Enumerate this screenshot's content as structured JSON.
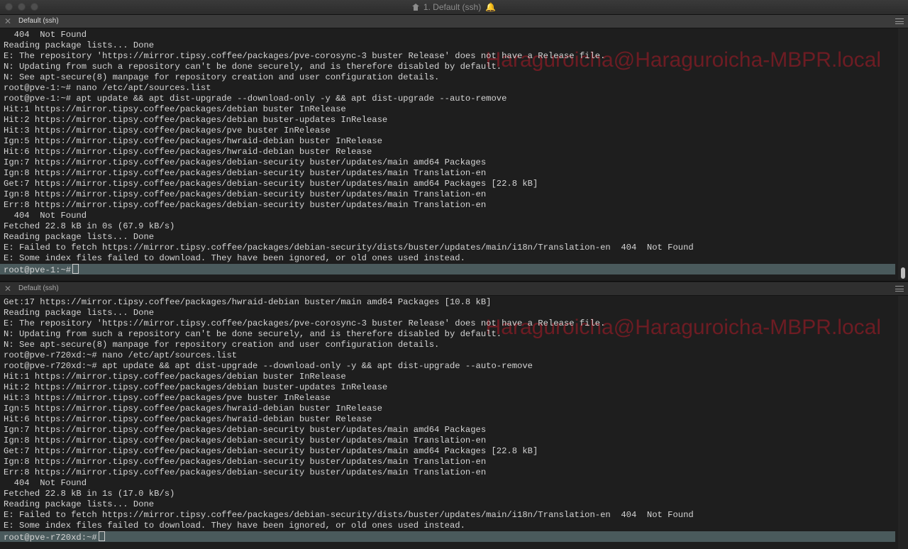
{
  "window": {
    "title": "1. Default (ssh)"
  },
  "colors": {
    "background": "#1e1e1e",
    "text": "#d4d4d4",
    "prompt_highlight": "#4a5a5c",
    "badge": "#af1c28",
    "bell": "#e0b400"
  },
  "top_pane": {
    "tab_label": "Default (ssh)",
    "badge": "Haraguroicha@Haraguroicha-MBPR.local",
    "lines": [
      "  404  Not Found",
      "Reading package lists... Done",
      "E: The repository 'https://mirror.tipsy.coffee/packages/pve-corosync-3 buster Release' does not have a Release file.",
      "N: Updating from such a repository can't be done securely, and is therefore disabled by default.",
      "N: See apt-secure(8) manpage for repository creation and user configuration details.",
      "root@pve-1:~# nano /etc/apt/sources.list",
      "root@pve-1:~# apt update && apt dist-upgrade --download-only -y && apt dist-upgrade --auto-remove",
      "Hit:1 https://mirror.tipsy.coffee/packages/debian buster InRelease",
      "Hit:2 https://mirror.tipsy.coffee/packages/debian buster-updates InRelease",
      "Hit:3 https://mirror.tipsy.coffee/packages/pve buster InRelease",
      "Ign:5 https://mirror.tipsy.coffee/packages/hwraid-debian buster InRelease",
      "Hit:6 https://mirror.tipsy.coffee/packages/hwraid-debian buster Release",
      "Ign:7 https://mirror.tipsy.coffee/packages/debian-security buster/updates/main amd64 Packages",
      "Ign:8 https://mirror.tipsy.coffee/packages/debian-security buster/updates/main Translation-en",
      "Get:7 https://mirror.tipsy.coffee/packages/debian-security buster/updates/main amd64 Packages [22.8 kB]",
      "Ign:8 https://mirror.tipsy.coffee/packages/debian-security buster/updates/main Translation-en",
      "Err:8 https://mirror.tipsy.coffee/packages/debian-security buster/updates/main Translation-en",
      "  404  Not Found",
      "Fetched 22.8 kB in 0s (67.9 kB/s)",
      "Reading package lists... Done",
      "E: Failed to fetch https://mirror.tipsy.coffee/packages/debian-security/dists/buster/updates/main/i18n/Translation-en  404  Not Found",
      "E: Some index files failed to download. They have been ignored, or old ones used instead."
    ],
    "prompt": "root@pve-1:~#"
  },
  "bottom_pane": {
    "tab_label": "Default (ssh)",
    "badge": "Haraguroicha@Haraguroicha-MBPR.local",
    "lines": [
      "Get:17 https://mirror.tipsy.coffee/packages/hwraid-debian buster/main amd64 Packages [10.8 kB]",
      "Reading package lists... Done",
      "E: The repository 'https://mirror.tipsy.coffee/packages/pve-corosync-3 buster Release' does not have a Release file.",
      "N: Updating from such a repository can't be done securely, and is therefore disabled by default.",
      "N: See apt-secure(8) manpage for repository creation and user configuration details.",
      "root@pve-r720xd:~# nano /etc/apt/sources.list",
      "root@pve-r720xd:~# apt update && apt dist-upgrade --download-only -y && apt dist-upgrade --auto-remove",
      "Hit:1 https://mirror.tipsy.coffee/packages/debian buster InRelease",
      "Hit:2 https://mirror.tipsy.coffee/packages/debian buster-updates InRelease",
      "Hit:3 https://mirror.tipsy.coffee/packages/pve buster InRelease",
      "Ign:5 https://mirror.tipsy.coffee/packages/hwraid-debian buster InRelease",
      "Hit:6 https://mirror.tipsy.coffee/packages/hwraid-debian buster Release",
      "Ign:7 https://mirror.tipsy.coffee/packages/debian-security buster/updates/main amd64 Packages",
      "Ign:8 https://mirror.tipsy.coffee/packages/debian-security buster/updates/main Translation-en",
      "Get:7 https://mirror.tipsy.coffee/packages/debian-security buster/updates/main amd64 Packages [22.8 kB]",
      "Ign:8 https://mirror.tipsy.coffee/packages/debian-security buster/updates/main Translation-en",
      "Err:8 https://mirror.tipsy.coffee/packages/debian-security buster/updates/main Translation-en",
      "  404  Not Found",
      "Fetched 22.8 kB in 1s (17.0 kB/s)",
      "Reading package lists... Done",
      "E: Failed to fetch https://mirror.tipsy.coffee/packages/debian-security/dists/buster/updates/main/i18n/Translation-en  404  Not Found",
      "E: Some index files failed to download. They have been ignored, or old ones used instead."
    ],
    "prompt": "root@pve-r720xd:~#"
  }
}
